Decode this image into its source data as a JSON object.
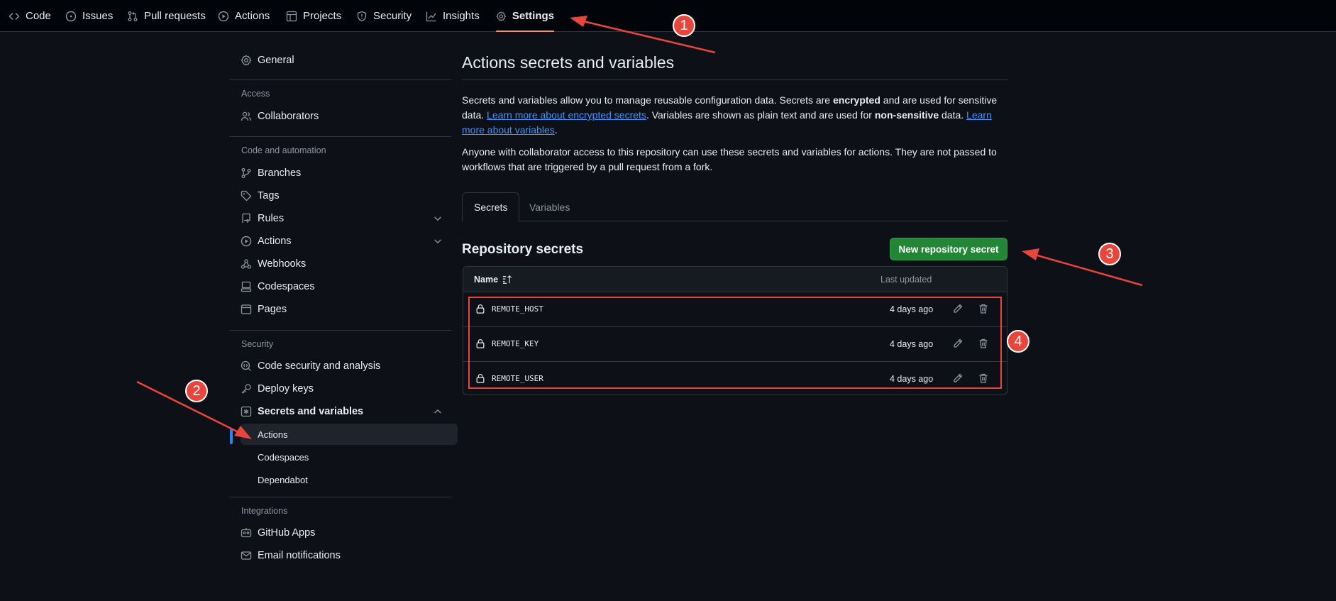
{
  "topnav": {
    "items": [
      {
        "label": "Code",
        "icon": "code-icon"
      },
      {
        "label": "Issues",
        "icon": "issue-icon"
      },
      {
        "label": "Pull requests",
        "icon": "pull-request-icon"
      },
      {
        "label": "Actions",
        "icon": "play-icon"
      },
      {
        "label": "Projects",
        "icon": "table-icon"
      },
      {
        "label": "Security",
        "icon": "shield-icon"
      },
      {
        "label": "Insights",
        "icon": "graph-icon"
      },
      {
        "label": "Settings",
        "icon": "gear-icon",
        "active": true
      }
    ]
  },
  "sidebar": {
    "general": "General",
    "headings": {
      "access": "Access",
      "code_automation": "Code and automation",
      "security": "Security",
      "integrations": "Integrations"
    },
    "collaborators": "Collaborators",
    "branches": "Branches",
    "tags": "Tags",
    "rules": "Rules",
    "actions": "Actions",
    "webhooks": "Webhooks",
    "codespaces": "Codespaces",
    "pages": "Pages",
    "code_security": "Code security and analysis",
    "deploy_keys": "Deploy keys",
    "secrets_variables": "Secrets and variables",
    "sub": {
      "actions": "Actions",
      "codespaces": "Codespaces",
      "dependabot": "Dependabot"
    },
    "github_apps": "GitHub Apps",
    "email_notifications": "Email notifications"
  },
  "main": {
    "title": "Actions secrets and variables",
    "para1": {
      "t1": "Secrets and variables allow you to manage reusable configuration data. Secrets are ",
      "b1": "encrypted",
      "t2": " and are used for sensitive data. ",
      "link1": "Learn more about encrypted secrets",
      "t3": ". Variables are shown as plain text and are used for ",
      "b2": "non-sensitive",
      "t4": " data. ",
      "link2": "Learn more about variables",
      "t5": "."
    },
    "para2": "Anyone with collaborator access to this repository can use these secrets and variables for actions. They are not passed to workflows that are triggered by a pull request from a fork.",
    "tabs": {
      "secrets": "Secrets",
      "variables": "Variables"
    },
    "section_title": "Repository secrets",
    "new_secret_button": "New repository secret",
    "table": {
      "col_name": "Name",
      "col_updated": "Last updated",
      "rows": [
        {
          "name": "REMOTE_HOST",
          "updated": "4 days ago"
        },
        {
          "name": "REMOTE_KEY",
          "updated": "4 days ago"
        },
        {
          "name": "REMOTE_USER",
          "updated": "4 days ago"
        }
      ]
    }
  },
  "annotations": {
    "badges": [
      "1",
      "2",
      "3",
      "4"
    ],
    "color": "#e8453c"
  },
  "colors": {
    "background": "#0d1117",
    "accent_link": "#4493f8",
    "primary_button": "#238636",
    "active_tab_underline": "#fd8c73",
    "selected_indicator": "#2f81f7"
  }
}
